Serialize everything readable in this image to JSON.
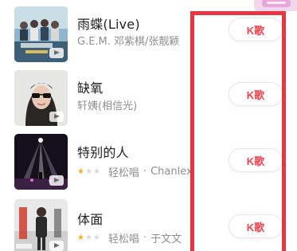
{
  "songs": [
    {
      "title": "雨蝶(Live)",
      "artist": "G.E.M. 邓紫棋/张靓颖",
      "stars": 0,
      "difficulty": "",
      "cover_icon": "concert-group-cover",
      "button_label": "K歌"
    },
    {
      "title": "缺氧",
      "artist": "轩姨(相信光)",
      "stars": 0,
      "difficulty": "",
      "cover_icon": "sunglasses-portrait-cover",
      "button_label": "K歌"
    },
    {
      "title": "特别的人",
      "artist": "Chanlex",
      "stars": 1,
      "difficulty": "轻松唱",
      "cover_icon": "stage-lights-cover",
      "button_label": "K歌"
    },
    {
      "title": "体面",
      "artist": "于文文",
      "stars": 1,
      "difficulty": "轻松唱",
      "cover_icon": "standing-person-cover",
      "button_label": "K歌"
    }
  ],
  "separator": "·",
  "colors": {
    "accent": "#f0424f",
    "highlight": "#e8353f",
    "star": "#f2b021"
  }
}
